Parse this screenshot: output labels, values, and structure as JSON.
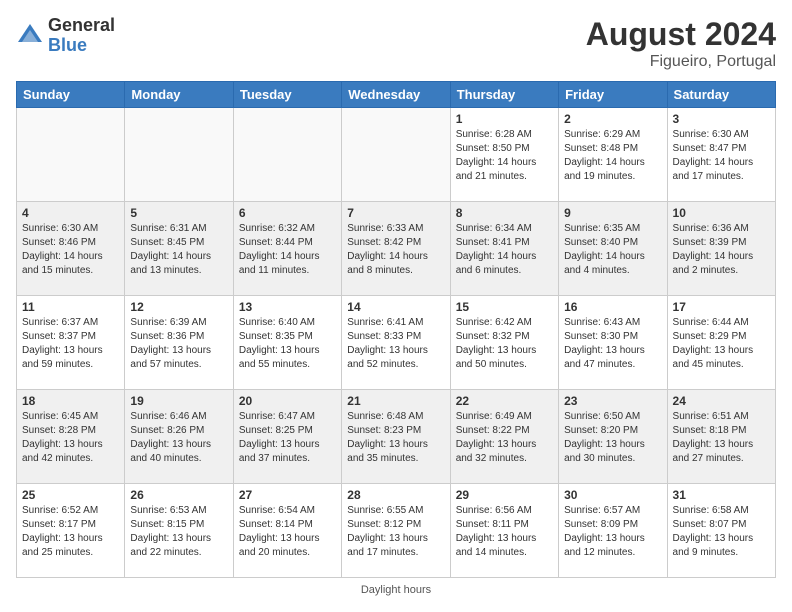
{
  "header": {
    "logo_line1": "General",
    "logo_line2": "Blue",
    "month_year": "August 2024",
    "location": "Figueiro, Portugal"
  },
  "days_of_week": [
    "Sunday",
    "Monday",
    "Tuesday",
    "Wednesday",
    "Thursday",
    "Friday",
    "Saturday"
  ],
  "weeks": [
    [
      {
        "day": "",
        "info": "",
        "empty": true
      },
      {
        "day": "",
        "info": "",
        "empty": true
      },
      {
        "day": "",
        "info": "",
        "empty": true
      },
      {
        "day": "",
        "info": "",
        "empty": true
      },
      {
        "day": "1",
        "info": "Sunrise: 6:28 AM\nSunset: 8:50 PM\nDaylight: 14 hours and 21 minutes.",
        "empty": false
      },
      {
        "day": "2",
        "info": "Sunrise: 6:29 AM\nSunset: 8:48 PM\nDaylight: 14 hours and 19 minutes.",
        "empty": false
      },
      {
        "day": "3",
        "info": "Sunrise: 6:30 AM\nSunset: 8:47 PM\nDaylight: 14 hours and 17 minutes.",
        "empty": false
      }
    ],
    [
      {
        "day": "4",
        "info": "Sunrise: 6:30 AM\nSunset: 8:46 PM\nDaylight: 14 hours and 15 minutes.",
        "empty": false
      },
      {
        "day": "5",
        "info": "Sunrise: 6:31 AM\nSunset: 8:45 PM\nDaylight: 14 hours and 13 minutes.",
        "empty": false
      },
      {
        "day": "6",
        "info": "Sunrise: 6:32 AM\nSunset: 8:44 PM\nDaylight: 14 hours and 11 minutes.",
        "empty": false
      },
      {
        "day": "7",
        "info": "Sunrise: 6:33 AM\nSunset: 8:42 PM\nDaylight: 14 hours and 8 minutes.",
        "empty": false
      },
      {
        "day": "8",
        "info": "Sunrise: 6:34 AM\nSunset: 8:41 PM\nDaylight: 14 hours and 6 minutes.",
        "empty": false
      },
      {
        "day": "9",
        "info": "Sunrise: 6:35 AM\nSunset: 8:40 PM\nDaylight: 14 hours and 4 minutes.",
        "empty": false
      },
      {
        "day": "10",
        "info": "Sunrise: 6:36 AM\nSunset: 8:39 PM\nDaylight: 14 hours and 2 minutes.",
        "empty": false
      }
    ],
    [
      {
        "day": "11",
        "info": "Sunrise: 6:37 AM\nSunset: 8:37 PM\nDaylight: 13 hours and 59 minutes.",
        "empty": false
      },
      {
        "day": "12",
        "info": "Sunrise: 6:39 AM\nSunset: 8:36 PM\nDaylight: 13 hours and 57 minutes.",
        "empty": false
      },
      {
        "day": "13",
        "info": "Sunrise: 6:40 AM\nSunset: 8:35 PM\nDaylight: 13 hours and 55 minutes.",
        "empty": false
      },
      {
        "day": "14",
        "info": "Sunrise: 6:41 AM\nSunset: 8:33 PM\nDaylight: 13 hours and 52 minutes.",
        "empty": false
      },
      {
        "day": "15",
        "info": "Sunrise: 6:42 AM\nSunset: 8:32 PM\nDaylight: 13 hours and 50 minutes.",
        "empty": false
      },
      {
        "day": "16",
        "info": "Sunrise: 6:43 AM\nSunset: 8:30 PM\nDaylight: 13 hours and 47 minutes.",
        "empty": false
      },
      {
        "day": "17",
        "info": "Sunrise: 6:44 AM\nSunset: 8:29 PM\nDaylight: 13 hours and 45 minutes.",
        "empty": false
      }
    ],
    [
      {
        "day": "18",
        "info": "Sunrise: 6:45 AM\nSunset: 8:28 PM\nDaylight: 13 hours and 42 minutes.",
        "empty": false
      },
      {
        "day": "19",
        "info": "Sunrise: 6:46 AM\nSunset: 8:26 PM\nDaylight: 13 hours and 40 minutes.",
        "empty": false
      },
      {
        "day": "20",
        "info": "Sunrise: 6:47 AM\nSunset: 8:25 PM\nDaylight: 13 hours and 37 minutes.",
        "empty": false
      },
      {
        "day": "21",
        "info": "Sunrise: 6:48 AM\nSunset: 8:23 PM\nDaylight: 13 hours and 35 minutes.",
        "empty": false
      },
      {
        "day": "22",
        "info": "Sunrise: 6:49 AM\nSunset: 8:22 PM\nDaylight: 13 hours and 32 minutes.",
        "empty": false
      },
      {
        "day": "23",
        "info": "Sunrise: 6:50 AM\nSunset: 8:20 PM\nDaylight: 13 hours and 30 minutes.",
        "empty": false
      },
      {
        "day": "24",
        "info": "Sunrise: 6:51 AM\nSunset: 8:18 PM\nDaylight: 13 hours and 27 minutes.",
        "empty": false
      }
    ],
    [
      {
        "day": "25",
        "info": "Sunrise: 6:52 AM\nSunset: 8:17 PM\nDaylight: 13 hours and 25 minutes.",
        "empty": false
      },
      {
        "day": "26",
        "info": "Sunrise: 6:53 AM\nSunset: 8:15 PM\nDaylight: 13 hours and 22 minutes.",
        "empty": false
      },
      {
        "day": "27",
        "info": "Sunrise: 6:54 AM\nSunset: 8:14 PM\nDaylight: 13 hours and 20 minutes.",
        "empty": false
      },
      {
        "day": "28",
        "info": "Sunrise: 6:55 AM\nSunset: 8:12 PM\nDaylight: 13 hours and 17 minutes.",
        "empty": false
      },
      {
        "day": "29",
        "info": "Sunrise: 6:56 AM\nSunset: 8:11 PM\nDaylight: 13 hours and 14 minutes.",
        "empty": false
      },
      {
        "day": "30",
        "info": "Sunrise: 6:57 AM\nSunset: 8:09 PM\nDaylight: 13 hours and 12 minutes.",
        "empty": false
      },
      {
        "day": "31",
        "info": "Sunrise: 6:58 AM\nSunset: 8:07 PM\nDaylight: 13 hours and 9 minutes.",
        "empty": false
      }
    ]
  ],
  "footer": "Daylight hours"
}
